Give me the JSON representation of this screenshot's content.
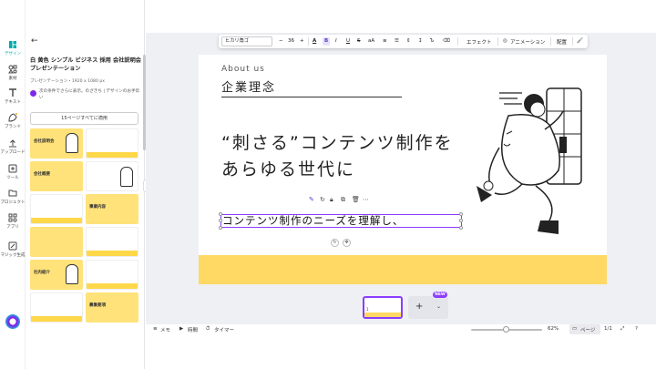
{
  "rail": [
    {
      "label": "デザイン",
      "icon": "design-icon"
    },
    {
      "label": "素材",
      "icon": "elements-icon"
    },
    {
      "label": "テキスト",
      "icon": "text-icon"
    },
    {
      "label": "ブランド",
      "icon": "brand-icon"
    },
    {
      "label": "アップロード",
      "icon": "upload-icon"
    },
    {
      "label": "ツール",
      "icon": "tools-icon"
    },
    {
      "label": "プロジェクト",
      "icon": "folder-icon"
    },
    {
      "label": "アプリ",
      "icon": "apps-icon"
    },
    {
      "label": "マジック生成",
      "icon": "magic-icon"
    }
  ],
  "panel": {
    "title": "白 黄色 シンプル ビジネス 採用 会社説明会 プレゼンテーション",
    "subtitle": "プレゼンテーション・1920 x 1080 px",
    "ai_hint": "次の条件でさらに表示。のざきち | デザインのお手伝い",
    "apply_button": "15ページすべてに適用",
    "thumbs": [
      "会社説明会",
      "",
      "会社概要",
      "",
      "",
      "事業内容",
      "",
      "",
      "社内紹介",
      "",
      "",
      "募集要項"
    ]
  },
  "toolbar": {
    "font": "ヒカリ角ゴ",
    "minus": "−",
    "size": "36",
    "plus": "+",
    "effects": "エフェクト",
    "animation": "アニメーション",
    "position": "配置"
  },
  "slide": {
    "about": "About us",
    "title": "企業理念",
    "headline_1": "“刺さる”コンテンツ制作を",
    "headline_2": "あらゆる世代に",
    "body": "コンテンツ制作のニーズを理解し、"
  },
  "pages": {
    "thumb_number": "1",
    "new_badge": "NEW"
  },
  "status": {
    "memo": "メモ",
    "time": "時間",
    "timer": "タイマー",
    "zoom": "62%",
    "pages": "ページ",
    "page_count": "1/1"
  }
}
